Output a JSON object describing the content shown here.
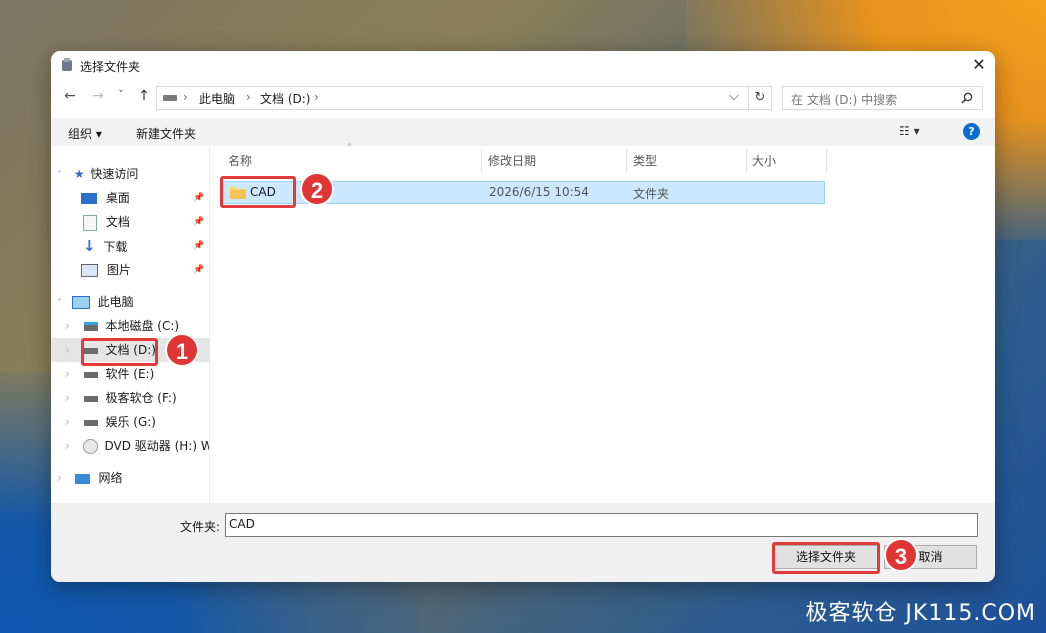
{
  "window": {
    "title": "选择文件夹",
    "close_glyph": "✕"
  },
  "nav": {
    "back": "←",
    "forward": "→",
    "recent": "˅",
    "up": "↑"
  },
  "address": {
    "crumbs": [
      "此电脑",
      "文档 (D:)"
    ],
    "sep": "›",
    "dropdown": "⌵",
    "refresh": "↻"
  },
  "search": {
    "placeholder": "在 文档 (D:) 中搜索"
  },
  "toolbar": {
    "organize": "组织 ▾",
    "new_folder": "新建文件夹",
    "view_icon": "☷ ▾",
    "help": "?"
  },
  "sidebar": {
    "quick_access": "快速访问",
    "quick_items": [
      {
        "label": "桌面",
        "icon": "desktop-icon"
      },
      {
        "label": "文档",
        "icon": "documents-icon"
      },
      {
        "label": "下载",
        "icon": "downloads-icon"
      },
      {
        "label": "图片",
        "icon": "pictures-icon"
      }
    ],
    "this_pc": "此电脑",
    "drives": [
      {
        "label": "本地磁盘 (C:)",
        "icon": "system-drive-icon"
      },
      {
        "label": "文档 (D:)",
        "icon": "drive-icon"
      },
      {
        "label": "软件 (E:)",
        "icon": "drive-icon"
      },
      {
        "label": "极客软仓 (F:)",
        "icon": "drive-icon"
      },
      {
        "label": "娱乐 (G:)",
        "icon": "drive-icon"
      },
      {
        "label": "DVD 驱动器 (H:) W",
        "icon": "dvd-icon"
      }
    ],
    "network": "网络"
  },
  "columns": {
    "name": "名称",
    "modified": "修改日期",
    "type": "类型",
    "size": "大小"
  },
  "files": [
    {
      "name": "CAD",
      "modified": "2026/6/15 10:54",
      "type": "文件夹",
      "size": ""
    }
  ],
  "footer": {
    "folder_label": "文件夹:",
    "folder_value": "CAD",
    "select_button": "选择文件夹",
    "cancel_button": "取消"
  },
  "annotations": {
    "step1": "1",
    "step2": "2",
    "step3": "3"
  },
  "watermark": "极客软仓 JK115.COM",
  "colors": {
    "accent_red": "#df3535",
    "selection": "#cce8ff",
    "help_blue": "#0b6fcf"
  }
}
